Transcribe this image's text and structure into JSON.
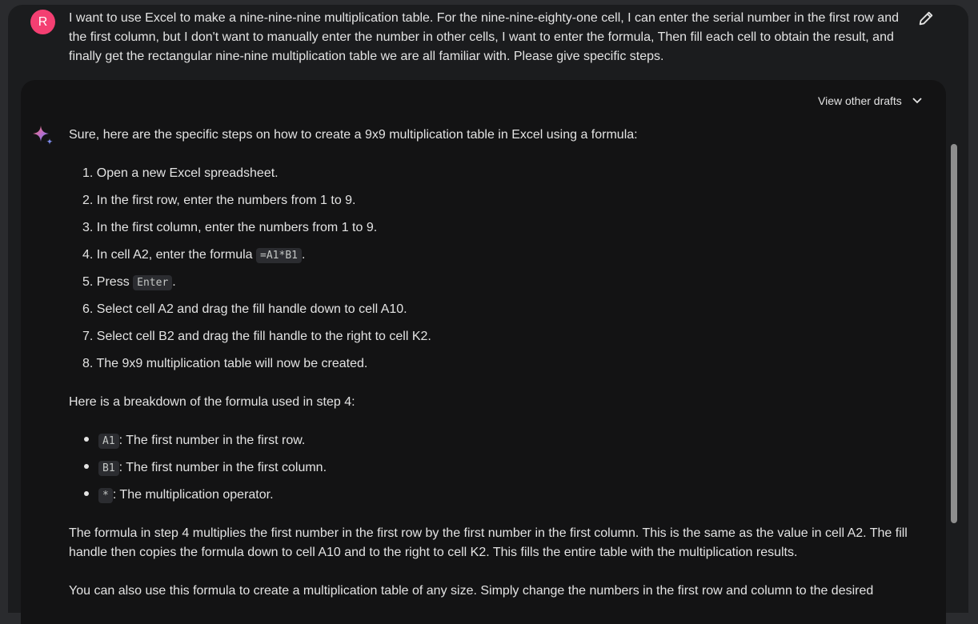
{
  "prompt": {
    "avatar_letter": "R",
    "text": "I want to use Excel to make a nine-nine-nine multiplication table. For the nine-nine-eighty-one cell, I can enter the serial number in the first row and the first column, but I don't want to manually enter the number in other cells, I want to enter the formula, Then fill each cell to obtain the result, and finally get the rectangular nine-nine multiplication table we are all familiar with. Please give specific steps."
  },
  "response": {
    "drafts_label": "View other drafts",
    "intro": "Sure, here are the specific steps on how to create a 9x9 multiplication table in Excel using a formula:",
    "steps": [
      {
        "num": "1.",
        "text": "Open a new Excel spreadsheet."
      },
      {
        "num": "2.",
        "text": "In the first row, enter the numbers from 1 to 9."
      },
      {
        "num": "3.",
        "text": "In the first column, enter the numbers from 1 to 9."
      },
      {
        "num": "4.",
        "pre": "In cell A2, enter the formula ",
        "code": "=A1*B1",
        "post": "."
      },
      {
        "num": "5.",
        "pre": "Press ",
        "code": "Enter",
        "post": "."
      },
      {
        "num": "6.",
        "text": "Select cell A2 and drag the fill handle down to cell A10."
      },
      {
        "num": "7.",
        "text": "Select cell B2 and drag the fill handle to the right to cell K2."
      },
      {
        "num": "8.",
        "text": "The 9x9 multiplication table will now be created."
      }
    ],
    "breakdown_heading": "Here is a breakdown of the formula used in step 4:",
    "bullets": [
      {
        "code": "A1",
        "text": ": The first number in the first row."
      },
      {
        "code": "B1",
        "text": ": The first number in the first column."
      },
      {
        "code": "*",
        "text": ": The multiplication operator."
      }
    ],
    "explanation": "The formula in step 4 multiplies the first number in the first row by the first number in the first column. This is the same as the value in cell A2. The fill handle then copies the formula down to cell A10 and to the right to cell K2. This fills the entire table with the multiplication results.",
    "closing": "You can also use this formula to create a multiplication table of any size. Simply change the numbers in the first row and column to the desired"
  },
  "colors": {
    "avatar": "#f43f72",
    "background": "#131314",
    "code_bg": "#2b2c30"
  },
  "icons": {
    "edit": "pencil-icon",
    "drafts": "chevron-down-icon",
    "assistant": "sparkle-icon"
  }
}
